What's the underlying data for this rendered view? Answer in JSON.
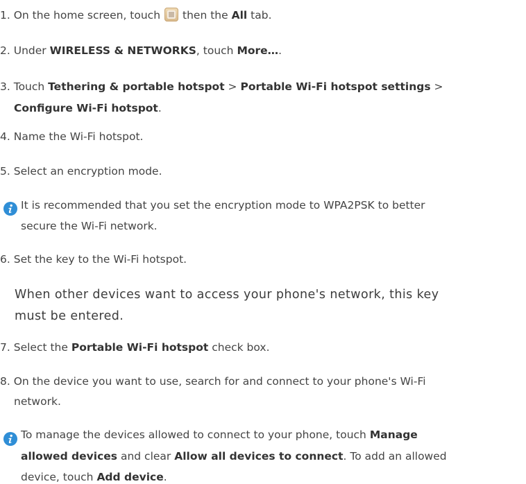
{
  "steps": {
    "s1": {
      "num": "1.",
      "pre": "On the home screen, touch",
      "mid": "then the",
      "bold": "All",
      "post": "tab."
    },
    "s2": {
      "num": "2.",
      "pre": "Under",
      "bold1": "WIRELESS & NETWORKS",
      "mid": ", touch",
      "bold2": "More…",
      "post": "."
    },
    "s3": {
      "num": "3.",
      "pre": "Touch",
      "bold1": "Tethering & portable hotspot",
      "sep1": ">",
      "bold2": "Portable Wi-Fi hotspot settings",
      "sep2": ">",
      "bold3": "Configure Wi-Fi hotspot",
      "post": "."
    },
    "s4": {
      "num": "4.",
      "text": "Name the Wi-Fi hotspot."
    },
    "s5": {
      "num": "5.",
      "text": "Select an encryption mode."
    },
    "s6": {
      "num": "6.",
      "text": "Set the key to the Wi-Fi hotspot."
    },
    "s7": {
      "num": "7.",
      "pre": "Select the",
      "bold": "Portable Wi-Fi hotspot",
      "post": "check box."
    },
    "s8": {
      "num": "8.",
      "line1": "On the device you want to use, search for and connect to your phone's Wi-Fi",
      "line2": "network."
    }
  },
  "note1": {
    "icon": "info-icon",
    "line1": "It is recommended that you set the encryption mode to WPA2PSK to better",
    "line2": "secure the Wi-Fi network."
  },
  "key_note": {
    "line1": "When other devices want to access your phone's network, this key",
    "line2": "must be entered."
  },
  "note2": {
    "icon": "info-icon",
    "l1_pre": "To manage the devices allowed to connect to your phone, touch",
    "l1_bold": "Manage",
    "l2_bold1": "allowed devices",
    "l2_mid": "and clear",
    "l2_bold2": "Allow all devices to connect",
    "l2_post": ". To add an allowed",
    "l3_pre": "device, touch",
    "l3_bold": "Add device",
    "l3_post": "."
  },
  "colors": {
    "text": "#444444",
    "info_icon": "#2f8ed6",
    "home_icon": "#d8b98c"
  }
}
